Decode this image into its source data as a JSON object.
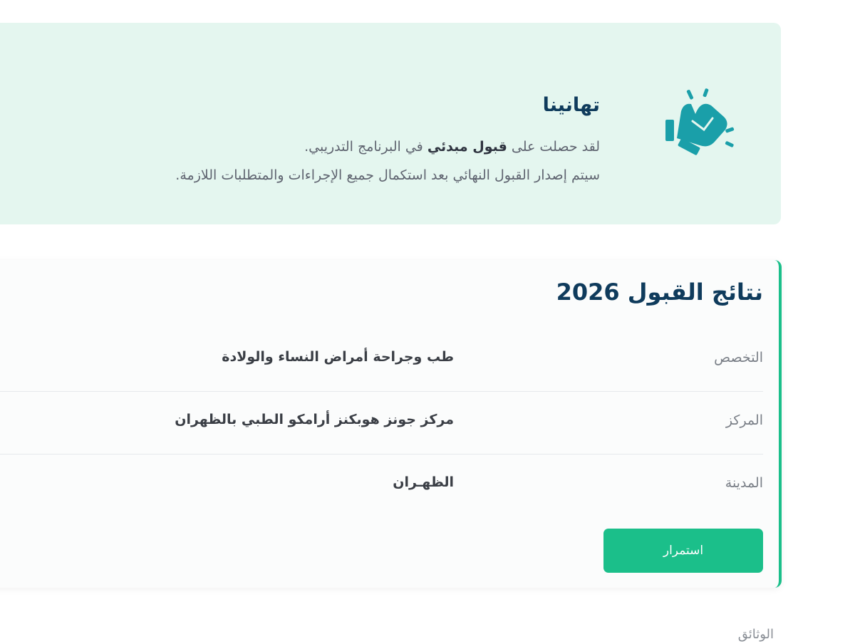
{
  "congrats": {
    "title": "تهانينا",
    "line1_before": "لقد حصلت على ",
    "line1_bold": "قبول مبدئي",
    "line1_after": " في البرنامج التدريبي.",
    "line2": "سيتم إصدار القبول النهائي بعد استكمال جميع الإجراءات والمتطلبات اللازمة.",
    "icon": "clapping-hands-icon"
  },
  "results": {
    "title": "نتائج القبول 2026",
    "rows": [
      {
        "label": "التخصص",
        "value": "طب وجراحة أمراض النساء والولادة"
      },
      {
        "label": "المركز",
        "value": "مركز جونز هوبكنز أرامكو الطبي بالظهران"
      },
      {
        "label": "المدينة",
        "value": "الظهـران"
      }
    ],
    "continue_label": "استمرار"
  },
  "documents": {
    "label": "الوثائق"
  },
  "colors": {
    "accent": "#1bbf8a",
    "banner_bg": "#e4f6ef",
    "title": "#0f3b5c",
    "icon": "#1a9fa9"
  }
}
